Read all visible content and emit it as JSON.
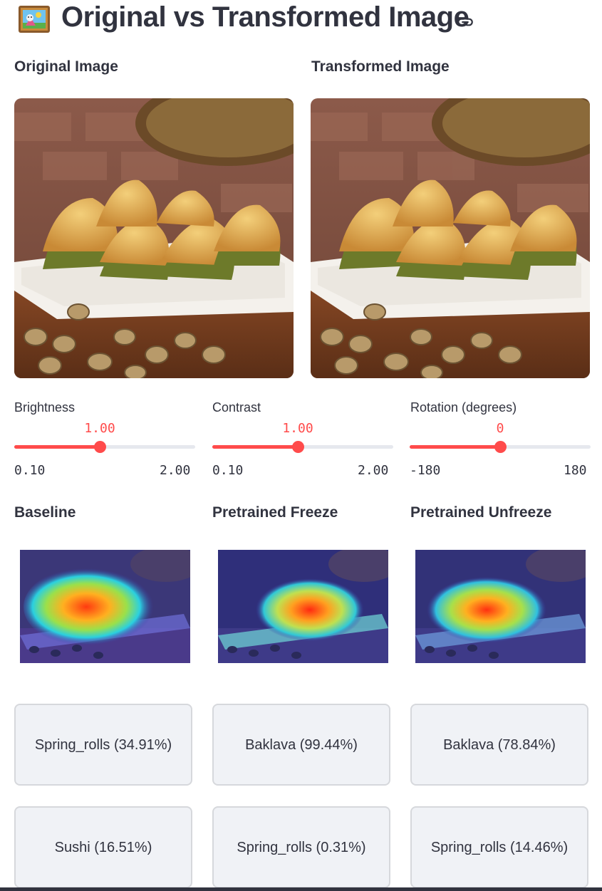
{
  "header": {
    "title": "Original vs Transformed Image",
    "title_icon": "framed-picture-icon",
    "link_icon": "link-icon"
  },
  "images": {
    "original_label": "Original Image",
    "transformed_label": "Transformed Image"
  },
  "sliders": [
    {
      "label": "Brightness",
      "value": "1.00",
      "min": "0.10",
      "max": "2.00",
      "fraction": 0.474
    },
    {
      "label": "Contrast",
      "value": "1.00",
      "min": "0.10",
      "max": "2.00",
      "fraction": 0.474
    },
    {
      "label": "Rotation (degrees)",
      "value": "0",
      "min": "-180",
      "max": "180",
      "fraction": 0.5
    }
  ],
  "models": [
    {
      "name": "Baseline",
      "predictions": [
        "Spring_rolls (34.91%)",
        "Sushi (16.51%)"
      ]
    },
    {
      "name": "Pretrained Freeze",
      "predictions": [
        "Baklava (99.44%)",
        "Spring_rolls (0.31%)"
      ]
    },
    {
      "name": "Pretrained Unfreeze",
      "predictions": [
        "Baklava (78.84%)",
        "Spring_rolls (14.46%)"
      ]
    }
  ],
  "colors": {
    "accent": "#ff4b4b",
    "text": "#31333f",
    "track": "#e6e8ee",
    "box_bg": "#f0f2f6",
    "box_border": "#d6d8dc"
  }
}
